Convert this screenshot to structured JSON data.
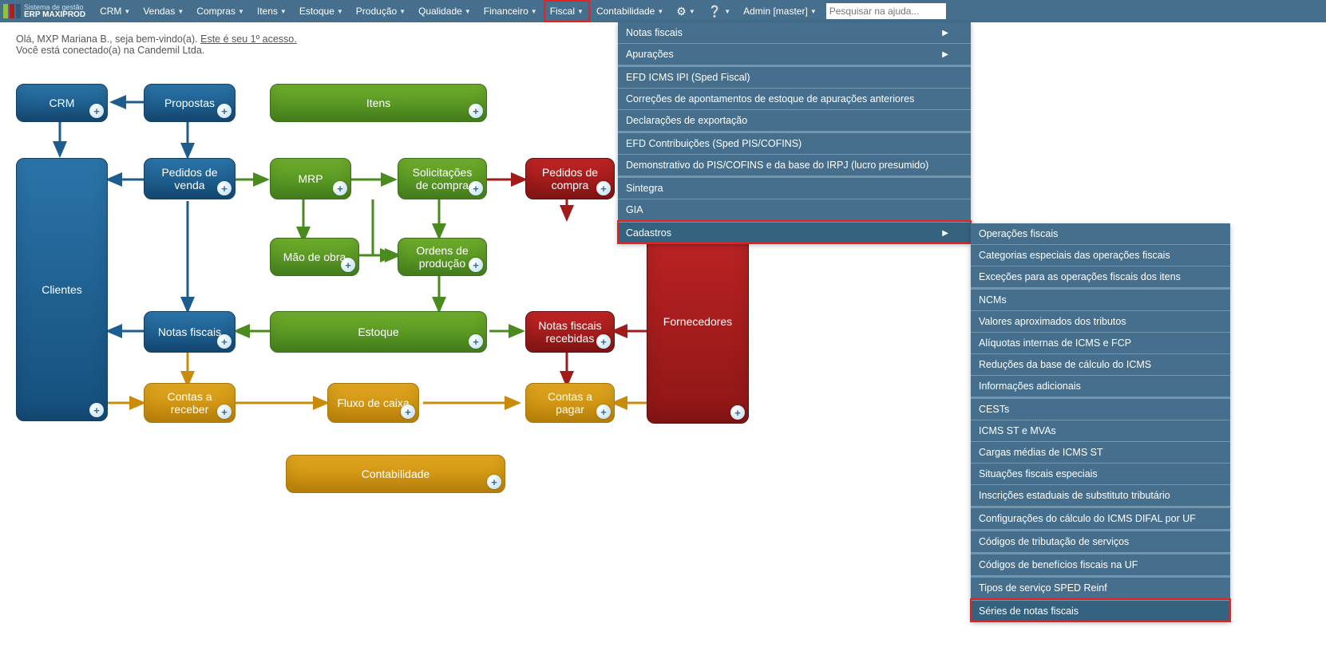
{
  "logo": {
    "line1": "Sistema de gestão",
    "line2": "ERP MAXIPROD"
  },
  "nav": {
    "crm": "CRM",
    "vendas": "Vendas",
    "compras": "Compras",
    "itens": "Itens",
    "estoque": "Estoque",
    "producao": "Produção",
    "qualidade": "Qualidade",
    "financeiro": "Financeiro",
    "fiscal": "Fiscal",
    "contabilidade": "Contabilidade",
    "admin": "Admin [master]",
    "search_placeholder": "Pesquisar na ajuda..."
  },
  "welcome": {
    "line1a": "Olá, MXP Mariana B., seja bem-vindo(a). ",
    "line1b": "Este é seu 1º acesso.",
    "line2": "Você está conectado(a) na Candemil Ltda."
  },
  "nodes": {
    "crm": "CRM",
    "propostas": "Propostas",
    "itens": "Itens",
    "clientes": "Clientes",
    "pedidos_venda": "Pedidos de venda",
    "mrp": "MRP",
    "solic_compra": "Solicitações de compra",
    "pedidos_compra": "Pedidos de compra",
    "mao_obra": "Mão de obra",
    "ordens_prod": "Ordens de produção",
    "notas_fiscais": "Notas fiscais",
    "estoque": "Estoque",
    "nf_recebidas": "Notas fiscais recebidas",
    "fornecedores": "Fornecedores",
    "contas_receber": "Contas a receber",
    "fluxo_caixa": "Fluxo de caixa",
    "contas_pagar": "Contas a pagar",
    "contabilidade": "Contabilidade"
  },
  "fiscal_menu": {
    "notas_fiscais": "Notas fiscais",
    "apuracoes": "Apurações",
    "efd_icms": "EFD ICMS IPI (Sped Fiscal)",
    "correcoes": "Correções de apontamentos de estoque de apurações anteriores",
    "declaracoes": "Declarações de exportação",
    "efd_contrib": "EFD Contribuições (Sped PIS/COFINS)",
    "demonstrativo": "Demonstrativo do PIS/COFINS e da base do IRPJ (lucro presumido)",
    "sintegra": "Sintegra",
    "gia": "GIA",
    "cadastros": "Cadastros"
  },
  "cadastros_menu": {
    "op_fiscais": "Operações fiscais",
    "cat_especiais": "Categorias especiais das operações fiscais",
    "excecoes": "Exceções para as operações fiscais dos itens",
    "ncms": "NCMs",
    "val_tributos": "Valores aproximados dos tributos",
    "aliquotas": "Alíquotas internas de ICMS e FCP",
    "reducoes": "Reduções da base de cálculo do ICMS",
    "info_adic": "Informações adicionais",
    "cests": "CESTs",
    "icms_st": "ICMS ST e MVAs",
    "cargas": "Cargas médias de ICMS ST",
    "situacoes": "Situações fiscais especiais",
    "inscricoes": "Inscrições estaduais de substituto tributário",
    "config_difal": "Configurações do cálculo do ICMS DIFAL por UF",
    "cod_trib": "Códigos de tributação de serviços",
    "cod_benef": "Códigos de benefícios fiscais na UF",
    "tipos_sped": "Tipos de serviço SPED Reinf",
    "series_nf": "Séries de notas fiscais"
  }
}
